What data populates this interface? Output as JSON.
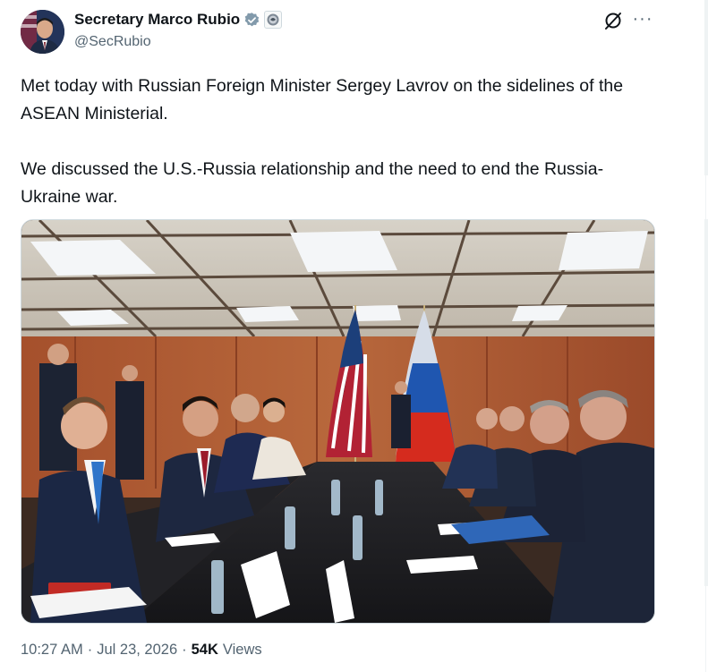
{
  "author": {
    "display_name": "Secretary Marco Rubio",
    "handle": "@SecRubio",
    "avatar_icon": "profile-photo",
    "verified_icon": "verified-badge-icon",
    "affiliation_icon": "government-seal-icon"
  },
  "actions": {
    "grok_icon": "grok-icon",
    "more_icon": "more-options-icon",
    "more_label": "···"
  },
  "tweet": {
    "text": "Met today with Russian Foreign Minister Sergey Lavrov on the sidelines of the ASEAN Ministerial.\n\nWe discussed the U.S.-Russia relationship and the need to end the Russia-Ukraine war."
  },
  "media": {
    "description_icon": "meeting-photo"
  },
  "meta": {
    "time": "10:27 AM",
    "sep1": "·",
    "date": "Jul 23, 2026",
    "sep2": "·",
    "views_count": "54K",
    "views_label": "Views"
  },
  "colors": {
    "text_primary": "#0f1419",
    "text_secondary": "#536471",
    "verified": "#829aab",
    "border": "#cfd9de"
  }
}
